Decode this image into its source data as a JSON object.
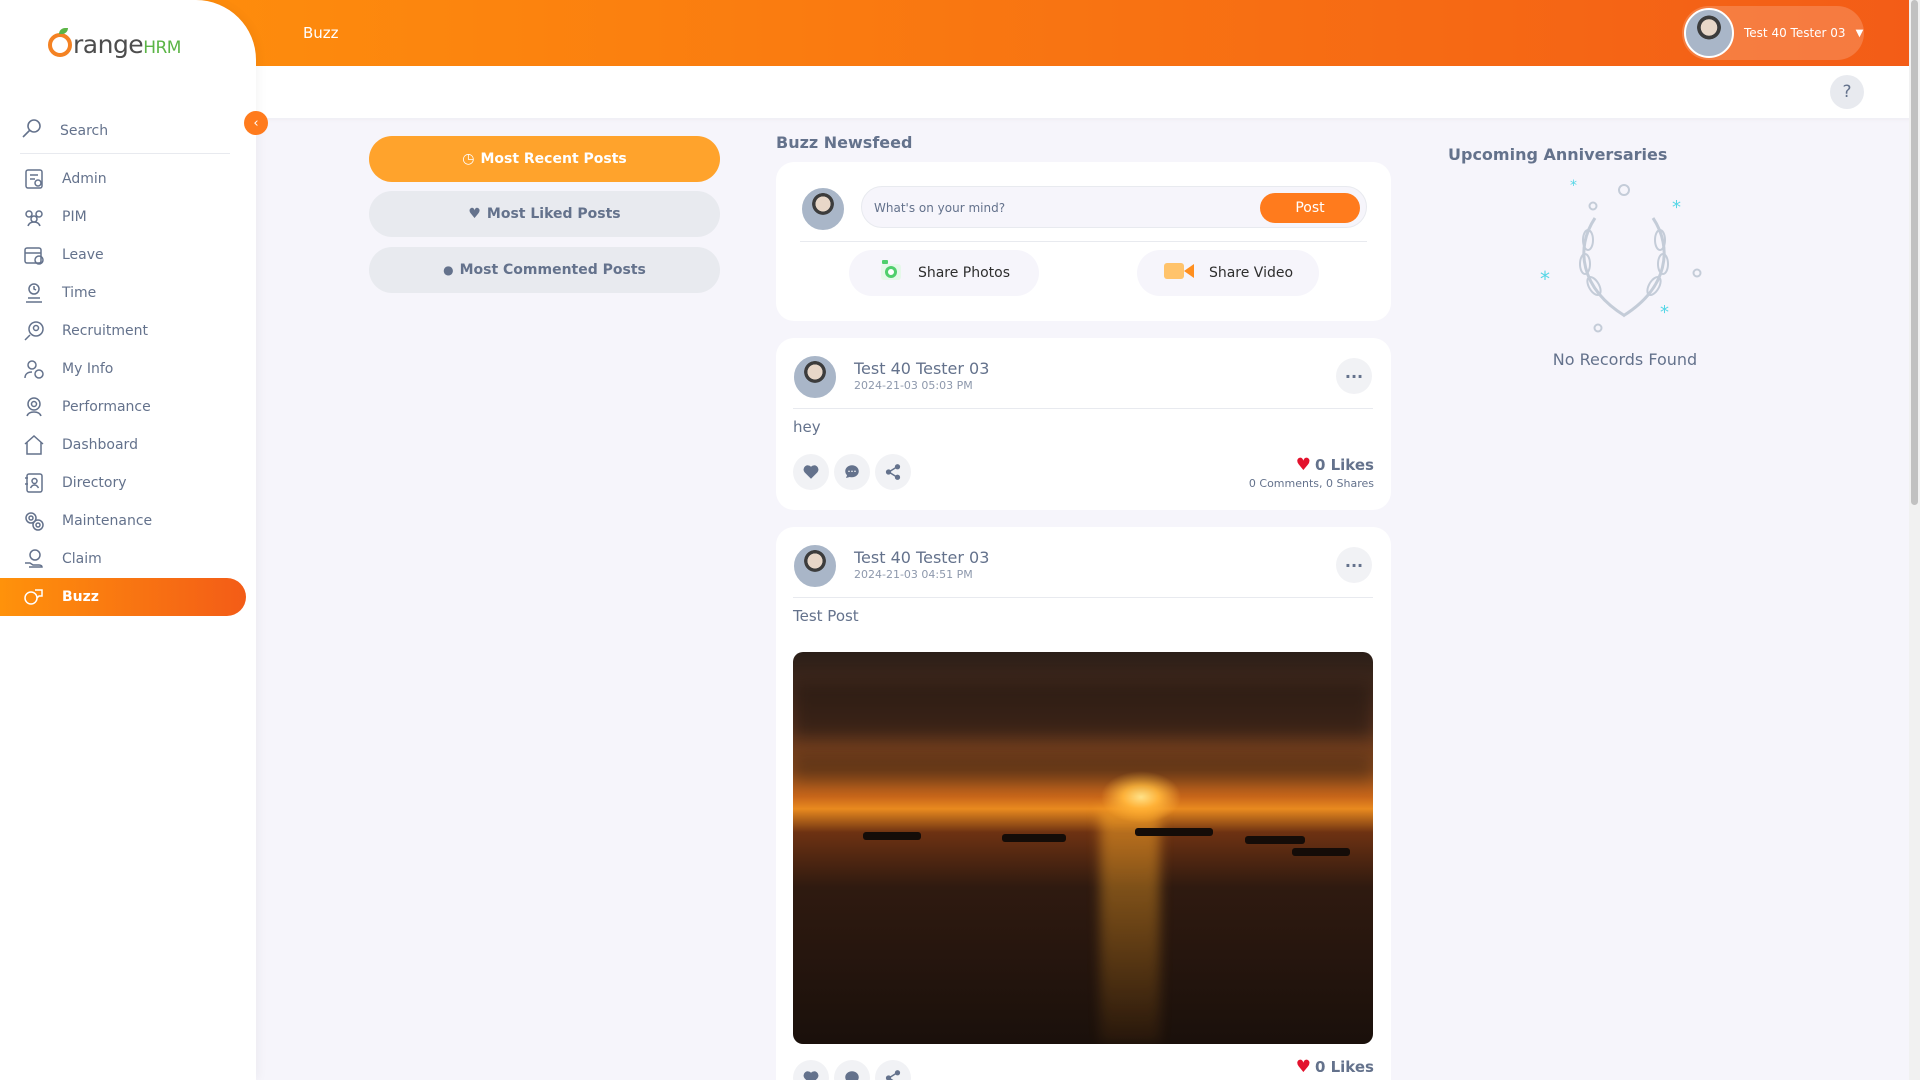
{
  "brand": {
    "orange": "range",
    "hrm": "HRM"
  },
  "sidebar": {
    "search_label": "Search",
    "items": [
      {
        "label": "Admin",
        "icon": "admin-icon"
      },
      {
        "label": "PIM",
        "icon": "pim-icon"
      },
      {
        "label": "Leave",
        "icon": "leave-icon"
      },
      {
        "label": "Time",
        "icon": "time-icon"
      },
      {
        "label": "Recruitment",
        "icon": "recruitment-icon"
      },
      {
        "label": "My Info",
        "icon": "my-info-icon"
      },
      {
        "label": "Performance",
        "icon": "performance-icon"
      },
      {
        "label": "Dashboard",
        "icon": "dashboard-icon"
      },
      {
        "label": "Directory",
        "icon": "directory-icon"
      },
      {
        "label": "Maintenance",
        "icon": "maintenance-icon"
      },
      {
        "label": "Claim",
        "icon": "claim-icon"
      },
      {
        "label": "Buzz",
        "icon": "buzz-icon",
        "active": true
      }
    ]
  },
  "header": {
    "breadcrumb": "Buzz",
    "user_name": "Test 40 Tester 03",
    "help": "?"
  },
  "filters": {
    "recent": "Most Recent Posts",
    "liked": "Most Liked Posts",
    "commented": "Most Commented Posts"
  },
  "feed": {
    "title": "Buzz Newsfeed",
    "composer": {
      "placeholder": "What's on your mind?",
      "post_label": "Post",
      "share_photos": "Share Photos",
      "share_video": "Share Video"
    },
    "posts": [
      {
        "author": "Test 40 Tester 03",
        "time": "2024-21-03 05:03 PM",
        "text": "hey",
        "likes": "0 Likes",
        "comments": "0 Comments",
        "shares": "0 Shares"
      },
      {
        "author": "Test 40 Tester 03",
        "time": "2024-21-03 04:51 PM",
        "text": "Test Post",
        "likes": "0 Likes"
      }
    ]
  },
  "anniversaries": {
    "title": "Upcoming Anniversaries",
    "empty": "No Records Found"
  },
  "colors": {
    "accent": "#ff7b1d",
    "gradient_start": "#ff920b",
    "gradient_end": "#f35c17",
    "filter_active": "#ffa32c",
    "like_red": "#e3122d"
  }
}
